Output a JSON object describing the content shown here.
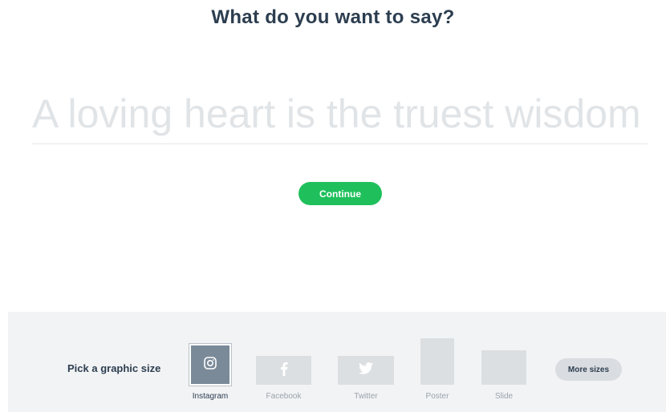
{
  "heading": "What do you want to say?",
  "message": {
    "placeholder": "A loving heart is the truest wisdom",
    "value": ""
  },
  "continue_label": "Continue",
  "size_picker": {
    "label": "Pick a graphic size",
    "options": [
      {
        "label": "Instagram",
        "icon": "instagram-icon",
        "selected": true
      },
      {
        "label": "Facebook",
        "icon": "facebook-icon",
        "selected": false
      },
      {
        "label": "Twitter",
        "icon": "twitter-icon",
        "selected": false
      },
      {
        "label": "Poster",
        "icon": "",
        "selected": false
      },
      {
        "label": "Slide",
        "icon": "",
        "selected": false
      }
    ],
    "more_label": "More sizes"
  },
  "colors": {
    "accent": "#1fc05c",
    "text": "#2c3e50",
    "panel": "#f2f3f5",
    "thumb": "#dcdfe2",
    "thumb_selected": "#7a8a99"
  }
}
